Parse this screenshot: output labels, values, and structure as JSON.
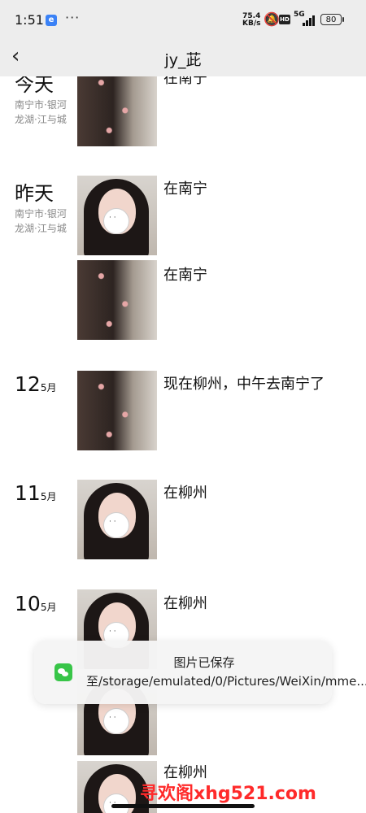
{
  "status_bar": {
    "time": "1:51",
    "app_badge": "e",
    "more": "···",
    "speed_value": "75.4",
    "speed_unit": "KB/s",
    "hd_badge": "HD",
    "network": "5G",
    "battery": "80",
    "icons": [
      "bell-mute-icon",
      "signal-icon",
      "battery-icon"
    ]
  },
  "nav": {
    "back_icon": "chevron-left-icon",
    "title": "jy_茈"
  },
  "moments": [
    {
      "date_label": "今天",
      "location": "南宁市·银河龙湖·江与城",
      "caption": "在南宁",
      "photo": "dress-photo"
    },
    {
      "date_label": "昨天",
      "location": "南宁市·银河龙湖·江与城",
      "caption": "在南宁",
      "photo": "selfie-photo"
    },
    {
      "date_label": "",
      "location": "",
      "caption": "在南宁",
      "photo": "dress-photo"
    },
    {
      "date_day": "12",
      "date_month": "5月",
      "caption": "现在柳州，中午去南宁了",
      "photo": "dress-photo"
    },
    {
      "date_day": "11",
      "date_month": "5月",
      "caption": "在柳州",
      "photo": "selfie-photo"
    },
    {
      "date_day": "10",
      "date_month": "5月",
      "caption": "在柳州",
      "photo": "selfie-photo"
    },
    {
      "caption": "在柳州",
      "photo": "selfie-photo"
    }
  ],
  "toast": {
    "icon": "wechat-icon",
    "message": "图片已保存至/storage/emulated/0/Pictures/WeiXin/mme..."
  },
  "watermark": "寻欢阁xhg521.com"
}
